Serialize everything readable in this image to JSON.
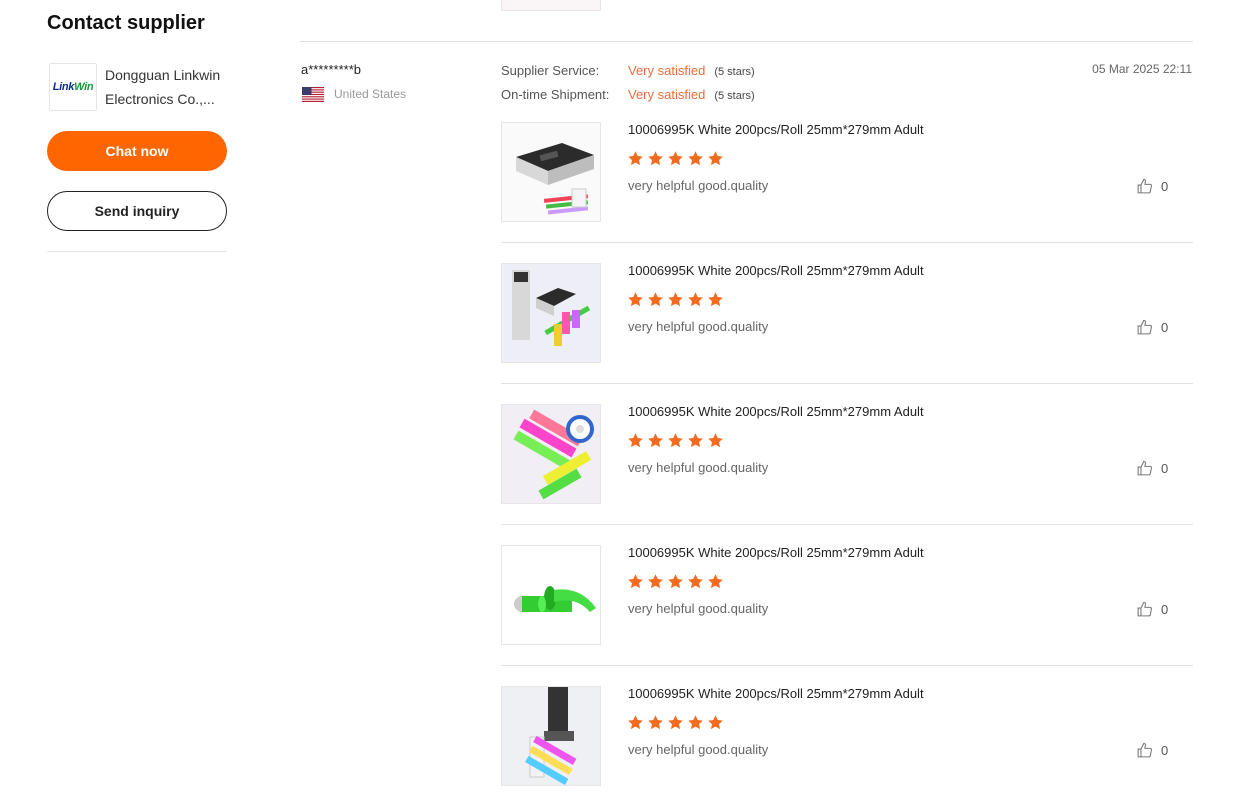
{
  "sidebar": {
    "title": "Contact supplier",
    "supplier": {
      "logo_text_a": "Link",
      "logo_text_b": "Win",
      "name": "Dongguan Linkwin Electronics Co.,..."
    },
    "chat_label": "Chat now",
    "inquiry_label": "Send inquiry"
  },
  "review": {
    "reviewer": "a*********b",
    "country": "United States",
    "flag_icon": "us-flag-icon",
    "date": "05 Mar 2025 22:11",
    "ratings": [
      {
        "label": "Supplier Service:",
        "value": "Very satisfied",
        "stars": "(5 stars)"
      },
      {
        "label": "On-time Shipment:",
        "value": "Very satisfied",
        "stars": "(5 stars)"
      }
    ],
    "accent_color": "#ff6600",
    "items": [
      {
        "title": "10006995K White 200pcs/Roll 25mm*279mm Adult",
        "rating": 5,
        "comment": "very helpful good.quality",
        "likes": "0"
      },
      {
        "title": "10006995K White 200pcs/Roll 25mm*279mm Adult",
        "rating": 5,
        "comment": "very helpful good.quality",
        "likes": "0"
      },
      {
        "title": "10006995K White 200pcs/Roll 25mm*279mm Adult",
        "rating": 5,
        "comment": "very helpful good.quality",
        "likes": "0"
      },
      {
        "title": "10006995K White 200pcs/Roll 25mm*279mm Adult",
        "rating": 5,
        "comment": "very helpful good.quality",
        "likes": "0"
      },
      {
        "title": "10006995K White 200pcs/Roll 25mm*279mm Adult",
        "rating": 5,
        "comment": "very helpful good.quality",
        "likes": "0"
      }
    ]
  }
}
